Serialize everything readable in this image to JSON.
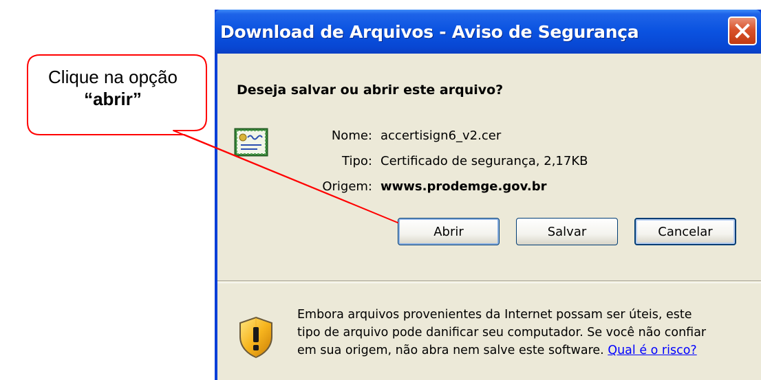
{
  "dialog": {
    "title": "Download de Arquivos - Aviso de Segurança",
    "question": "Deseja salvar ou abrir este arquivo?",
    "file_icon": "certificate-icon",
    "fields": [
      {
        "label": "Nome:",
        "value": "accertisign6_v2.cer",
        "bold": false
      },
      {
        "label": "Tipo:",
        "value": "Certificado de segurança, 2,17KB",
        "bold": false
      },
      {
        "label": "Origem:",
        "value": "wwws.prodemge.gov.br",
        "bold": true
      }
    ],
    "buttons": {
      "open": "Abrir",
      "save": "Salvar",
      "cancel": "Cancelar"
    },
    "warning": {
      "icon": "warning-shield-icon",
      "lines": [
        "Embora arquivos provenientes da Internet possam ser úteis, este",
        "tipo de arquivo pode danificar seu computador. Se você não confiar",
        "em sua origem, não abra nem salve este software."
      ],
      "link": "Qual é o risco?"
    }
  },
  "callout": {
    "line1": "Clique na opção",
    "line2": "“abrir”",
    "border_color": "#ff0000"
  },
  "colors": {
    "titlebar": "#0a52e0",
    "client_bg": "#ece9d8",
    "close_button": "#d9532c",
    "link": "#0000ff"
  }
}
